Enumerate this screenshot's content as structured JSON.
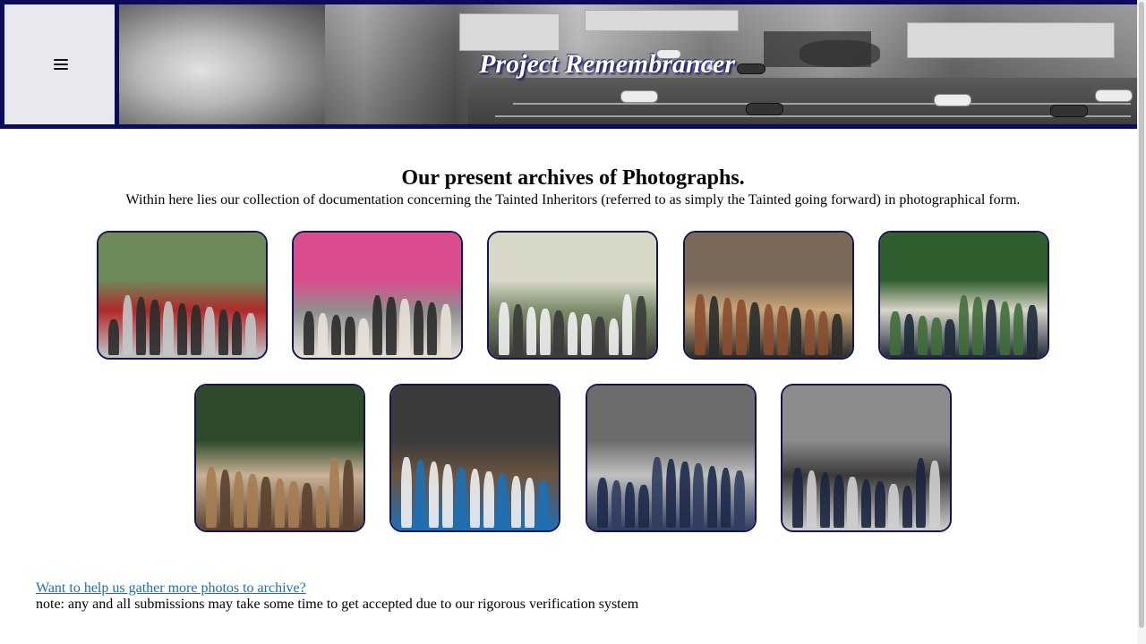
{
  "header": {
    "site_title": "Project Remembrancer",
    "menu_icon": "hamburger-menu-icon",
    "banner_image": "grayscale rooftop view of a parking lot and street",
    "colors": {
      "frame": "#0c0c5c",
      "menu_bg": "#e8e8ef",
      "title_text": "#ffffff"
    }
  },
  "main": {
    "heading": "Our present archives of Photographs.",
    "intro": "Within here lies our collection of documentation concerning the Tainted Inheritors (referred to as simply the Tainted going forward) in photographical form."
  },
  "gallery": {
    "photos": [
      {
        "alt": "group photo outdoors under trees",
        "palette": [
          "#6e8a5b",
          "#2b2b2b",
          "#c3c7c9",
          "#b12a2a"
        ]
      },
      {
        "alt": "group photo in front of pink backdrop",
        "palette": [
          "#d94d8c",
          "#2a2a2a",
          "#e8e1d8",
          "#8e8e8e"
        ]
      },
      {
        "alt": "group photo indoors in school uniforms",
        "palette": [
          "#d8d8c9",
          "#f1f1f1",
          "#3b3b3b",
          "#7c8c6a"
        ]
      },
      {
        "alt": "group photo in batik outside building",
        "palette": [
          "#7a6a5a",
          "#8a4c2f",
          "#2b2b2b",
          "#c9a67a"
        ]
      },
      {
        "alt": "group photo in front of green ivy wall",
        "palette": [
          "#2f5f2f",
          "#3f6e3a",
          "#1e2a3a",
          "#d9d4c8"
        ]
      },
      {
        "alt": "group photo in scout uniforms",
        "palette": [
          "#2f4a2a",
          "#a67c52",
          "#5a4030",
          "#c9b296"
        ]
      },
      {
        "alt": "group selfie indoors",
        "palette": [
          "#3b3b3b",
          "#efefef",
          "#1f6fb3",
          "#6a5440"
        ]
      },
      {
        "alt": "group photo under Matland School sign",
        "palette": [
          "#6c6c6c",
          "#1c2a4a",
          "#2f3d5e",
          "#c0c0c0"
        ]
      },
      {
        "alt": "group photo in corridor in navy jackets",
        "palette": [
          "#8c8c8c",
          "#1c2440",
          "#cfcfcf",
          "#3a3a3a"
        ]
      }
    ],
    "border_color": "#141450"
  },
  "footer": {
    "link_text": "Want to help us gather more photos to archive?",
    "note": "note: any and all submissions may take some time to get accepted due to our rigorous verification system",
    "link_color": "#1a6fb0"
  }
}
